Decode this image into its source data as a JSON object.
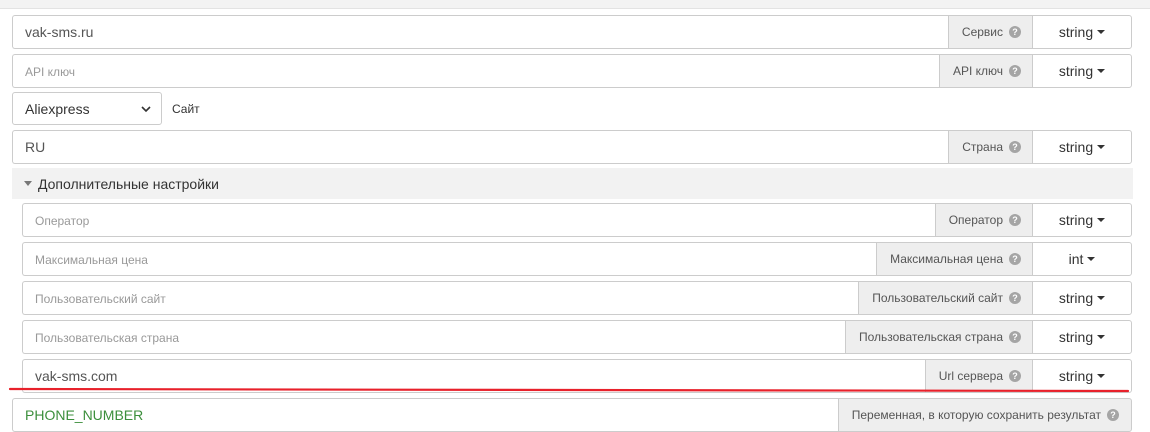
{
  "rows": {
    "service": {
      "value": "vak-sms.ru",
      "placeholder": "",
      "label": "Сервис",
      "type": "string"
    },
    "api_key": {
      "value": "",
      "placeholder": "API ключ",
      "label": "API ключ",
      "type": "string"
    },
    "country": {
      "value": "RU",
      "placeholder": "",
      "label": "Страна",
      "type": "string"
    }
  },
  "site": {
    "selected": "Aliexpress",
    "label": "Сайт"
  },
  "advanced": {
    "title": "Дополнительные настройки",
    "operator": {
      "value": "",
      "placeholder": "Оператор",
      "label": "Оператор",
      "type": "string"
    },
    "max_price": {
      "value": "",
      "placeholder": "Максимальная цена",
      "label": "Максимальная цена",
      "type": "int"
    },
    "custom_site": {
      "value": "",
      "placeholder": "Пользовательский сайт",
      "label": "Пользовательский сайт",
      "type": "string"
    },
    "custom_country": {
      "value": "",
      "placeholder": "Пользовательская страна",
      "label": "Пользовательская страна",
      "type": "string"
    },
    "server_url": {
      "value": "vak-sms.com",
      "placeholder": "",
      "label": "Url сервера",
      "type": "string"
    }
  },
  "result": {
    "value": "PHONE_NUMBER",
    "label": "Переменная, в которую сохранить результат"
  },
  "help_glyph": "?",
  "colors": {
    "annotation_red": "#e8212b",
    "variable_green": "#3c8f3c"
  }
}
